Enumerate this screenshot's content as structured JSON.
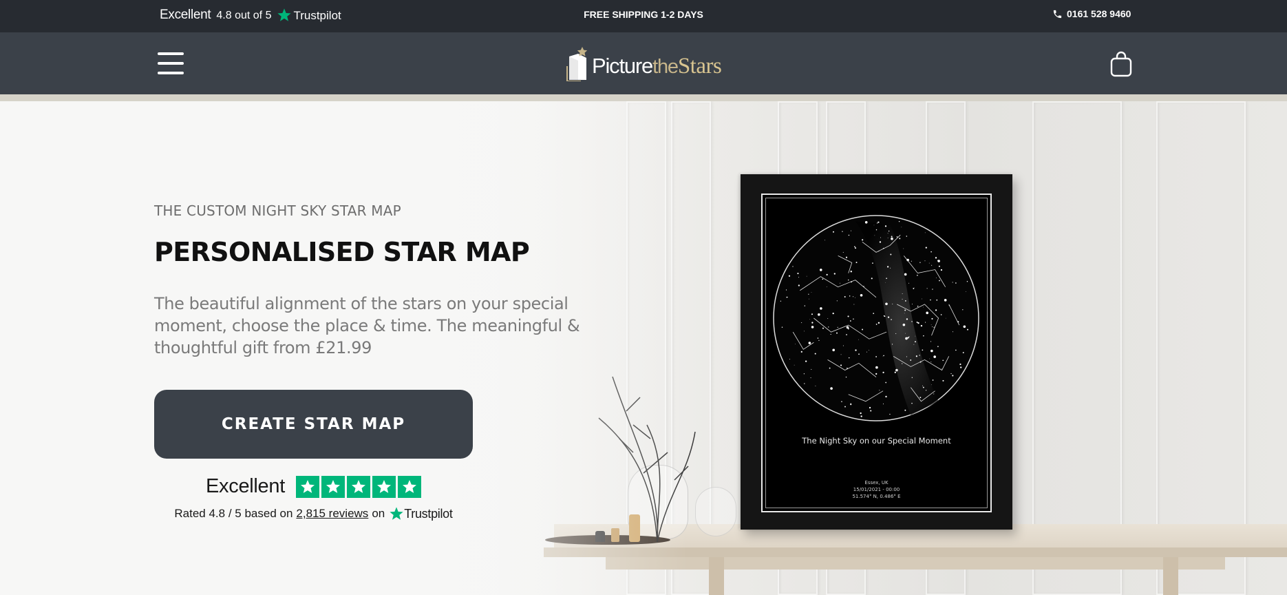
{
  "topbar": {
    "tp_excellent": "Excellent",
    "tp_rating": "4.8 out of 5",
    "tp_brand": "Trustpilot",
    "shipping": "FREE SHIPPING 1-2 DAYS",
    "phone": "0161 528 9460"
  },
  "nav": {
    "logo": {
      "picture": "Picture",
      "the": "the",
      "stars": "Stars"
    }
  },
  "hero": {
    "eyebrow": "THE CUSTOM NIGHT SKY STAR MAP",
    "title": "PERSONALISED STAR MAP",
    "description": "The beautiful alignment of the stars on your special moment, choose the place & time. The meaningful & thoughtful gift from £21.99",
    "cta_label": "CREATE STAR MAP"
  },
  "trustpilot": {
    "excellent": "Excellent",
    "rated_prefix": "Rated 4.8 / 5 based on",
    "reviews_link": "2,815 reviews",
    "on": "on",
    "brand": "Trustpilot",
    "stars": 5
  },
  "poster": {
    "caption": "The Night Sky on our Special Moment",
    "location": "Essex, UK",
    "datetime": "15/01/2021 - 00:00",
    "coords": "51.574° N, 0.486° E"
  },
  "colors": {
    "topbar_bg": "#272b31",
    "nav_bg": "#3b4149",
    "cta_bg": "#3b4149",
    "trustpilot_green": "#00b67a",
    "logo_gold": "#d8c490"
  },
  "icons": [
    "trustpilot-star-icon",
    "phone-icon",
    "hamburger-menu-icon",
    "shopping-bag-icon",
    "logo-mark-icon"
  ]
}
